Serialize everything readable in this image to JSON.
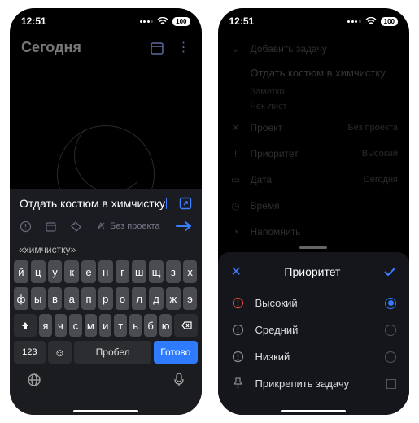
{
  "status": {
    "time": "12:51",
    "battery": "100"
  },
  "phone1": {
    "header_title": "Сегодня",
    "task_input": "Отдать костюм в химчистку",
    "no_project": "Без проекта",
    "suggest": "«химчистку»",
    "keyboard": {
      "row1": [
        "й",
        "ц",
        "у",
        "к",
        "е",
        "н",
        "г",
        "ш",
        "щ",
        "з",
        "х"
      ],
      "row2": [
        "ф",
        "ы",
        "в",
        "а",
        "п",
        "р",
        "о",
        "л",
        "д",
        "ж",
        "э"
      ],
      "row3": [
        "я",
        "ч",
        "с",
        "м",
        "и",
        "т",
        "ь",
        "б",
        "ю"
      ],
      "k123": "123",
      "space": "Пробел",
      "done": "Готово"
    }
  },
  "phone2": {
    "add_task": "Добавить задачу",
    "task_name": "Отдать костюм в химчистку",
    "notes": "Заметки",
    "checklist": "Чек-лист",
    "rows": {
      "project": {
        "label": "Проект",
        "value": "Без проекта"
      },
      "priority": {
        "label": "Приоритет",
        "value": "Высокий"
      },
      "date": {
        "label": "Дата",
        "value": "Сегодня"
      },
      "time": {
        "label": "Время"
      },
      "reminder": {
        "label": "Напомнить"
      }
    },
    "sheet": {
      "title": "Приоритет",
      "options": {
        "high": "Высокий",
        "medium": "Средний",
        "low": "Низкий",
        "pin": "Прикрепить задачу"
      }
    }
  }
}
